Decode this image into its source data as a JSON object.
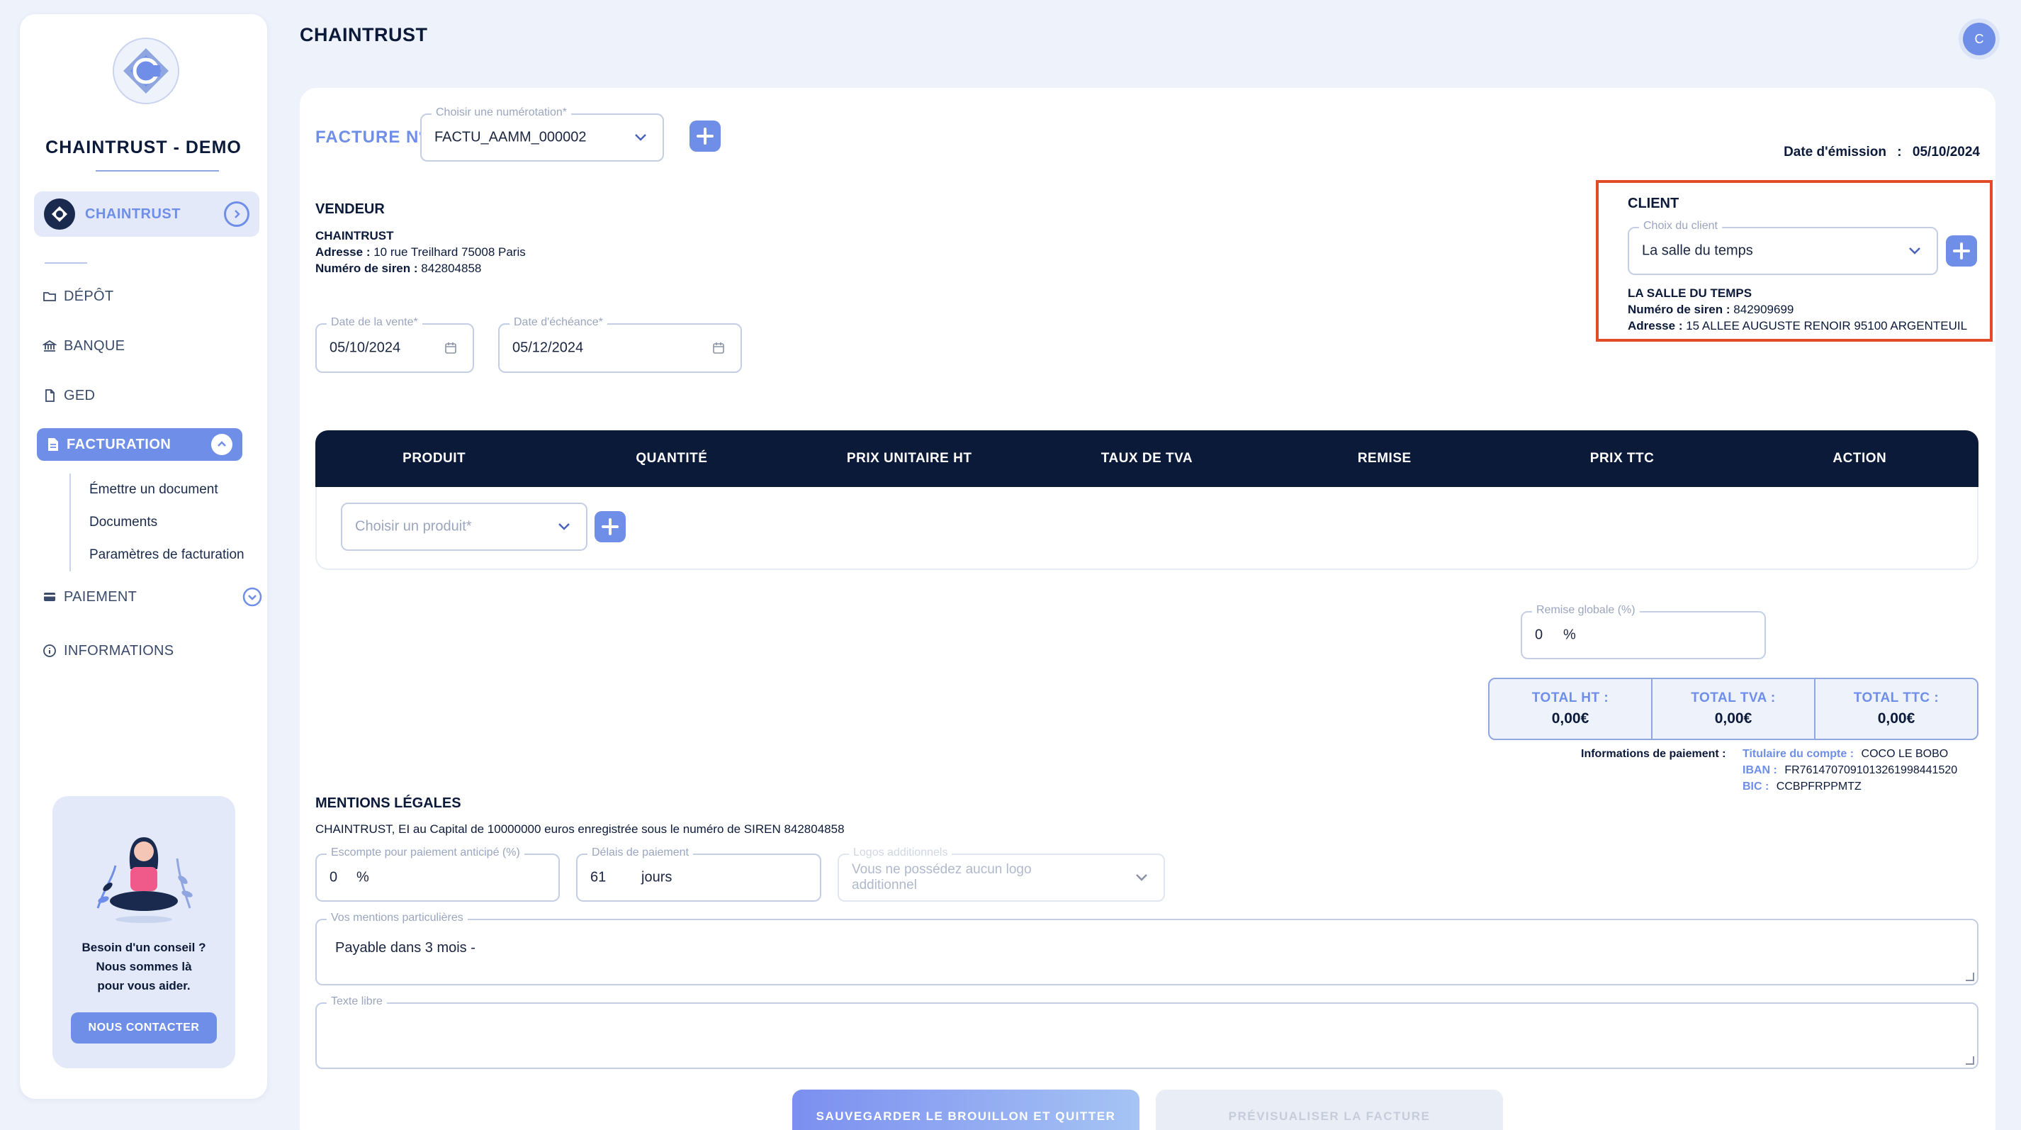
{
  "sidebar": {
    "brand": "CHAINTRUST - DEMO",
    "org_label": "CHAINTRUST",
    "nav": {
      "depot": "DÉPÔT",
      "banque": "BANQUE",
      "ged": "GED",
      "facturation": "FACTURATION",
      "paiement": "PAIEMENT",
      "informations": "INFORMATIONS"
    },
    "subnav": [
      "Émettre un document",
      "Documents",
      "Paramètres de facturation"
    ],
    "help": {
      "line1": "Besoin d'un conseil ?",
      "line2": "Nous sommes là",
      "line3": "pour vous aider.",
      "button": "NOUS CONTACTER"
    }
  },
  "header": {
    "title": "CHAINTRUST",
    "avatar_initial": "C"
  },
  "invoice": {
    "facture_label": "FACTURE Nº",
    "numerotation": {
      "legend": "Choisir une numérotation*",
      "value": "FACTU_AAMM_000002"
    },
    "date_emission_label": "Date d'émission",
    "date_emission_sep": ":",
    "date_emission_value": "05/10/2024",
    "vendeur": {
      "title": "VENDEUR",
      "name": "CHAINTRUST",
      "address_label": "Adresse :",
      "address": "10 rue Treilhard 75008 Paris",
      "siren_label": "Numéro de siren :",
      "siren": "842804858"
    },
    "date_vente": {
      "legend": "Date de la vente*",
      "value": "05/10/2024"
    },
    "date_echeance": {
      "legend": "Date d'échéance*",
      "value": "05/12/2024"
    },
    "client": {
      "title": "CLIENT",
      "select_legend": "Choix du client",
      "select_value": "La salle du temps",
      "name": "LA SALLE DU TEMPS",
      "siren_label": "Numéro de siren :",
      "siren": "842909699",
      "address_label": "Adresse :",
      "address": "15 ALLEE AUGUSTE RENOIR 95100 ARGENTEUIL"
    },
    "table": {
      "columns": [
        "PRODUIT",
        "QUANTITÉ",
        "PRIX UNITAIRE HT",
        "TAUX DE TVA",
        "REMISE",
        "PRIX TTC",
        "ACTION"
      ],
      "product_placeholder": "Choisir un produit*"
    },
    "remise_globale": {
      "legend": "Remise globale (%)",
      "value": "0",
      "unit": "%"
    },
    "totals": [
      {
        "label": "TOTAL HT :",
        "value": "0,00€"
      },
      {
        "label": "TOTAL TVA :",
        "value": "0,00€"
      },
      {
        "label": "TOTAL TTC :",
        "value": "0,00€"
      }
    ],
    "payment_info": {
      "label": "Informations de paiement :",
      "holder_label": "Titulaire du compte :",
      "holder": "COCO LE BOBO",
      "iban_label": "IBAN :",
      "iban": "FR7614707091013261998441520",
      "bic_label": "BIC :",
      "bic": "CCBPFRPPMTZ"
    },
    "mentions": {
      "title": "MENTIONS LÉGALES",
      "text": "CHAINTRUST, EI au Capital de 10000000 euros enregistrée sous le numéro de SIREN 842804858",
      "escompte": {
        "legend": "Escompte pour paiement anticipé (%)",
        "value": "0",
        "unit": "%"
      },
      "delais": {
        "legend": "Délais de paiement",
        "value": "61",
        "unit": "jours"
      },
      "logos": {
        "legend": "Logos additionnels",
        "placeholder": "Vous ne possédez aucun logo additionnel"
      },
      "particulieres": {
        "legend": "Vos mentions particulières",
        "value": "Payable dans 3 mois -"
      },
      "texte_libre": {
        "legend": "Texte libre",
        "value": ""
      }
    },
    "buttons": {
      "save": "SAUVEGARDER LE BROUILLON ET QUITTER",
      "preview": "PRÉVISUALISER LA FACTURE"
    }
  },
  "colors": {
    "accent": "#6f8ee8",
    "navy": "#0c1a3a",
    "highlight": "#e14a2a"
  }
}
